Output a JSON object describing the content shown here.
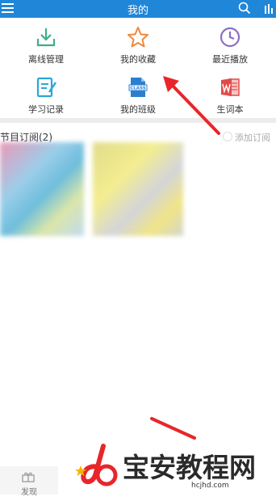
{
  "header": {
    "title": "我的"
  },
  "grid": {
    "items": [
      {
        "label": "离线管理",
        "icon": "download-icon",
        "color": "#3fae86"
      },
      {
        "label": "我的收藏",
        "icon": "star-icon",
        "color": "#f08a3c"
      },
      {
        "label": "最近播放",
        "icon": "clock-icon",
        "color": "#8a6fc6"
      },
      {
        "label": "学习记录",
        "icon": "notebook-icon",
        "color": "#2aa7d9"
      },
      {
        "label": "我的班级",
        "icon": "class-file-icon",
        "color": "#2a7fd1"
      },
      {
        "label": "生词本",
        "icon": "word-icon",
        "color": "#e24a4a"
      }
    ]
  },
  "subscriptions": {
    "title": "节目订阅(2)",
    "add_label": "添加订阅"
  },
  "tabbar": {
    "discover_label": "发现"
  },
  "watermark": {
    "text": "宝安教程网",
    "url": "hcjhd.com"
  },
  "colors": {
    "header_bg": "#1f86d8",
    "arrow": "#e8262a"
  }
}
